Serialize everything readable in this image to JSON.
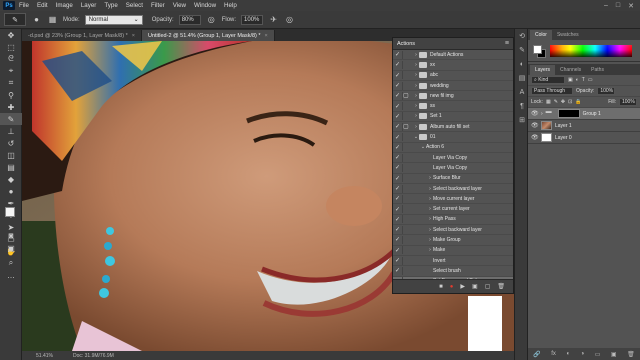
{
  "app": {
    "logo": "Ps"
  },
  "menu": [
    "File",
    "Edit",
    "Image",
    "Layer",
    "Type",
    "Select",
    "Filter",
    "View",
    "Window",
    "Help"
  ],
  "window_controls": [
    "–",
    "□",
    "✕"
  ],
  "options": {
    "mode_label": "Mode:",
    "mode_value": "Normal",
    "opacity_label": "Opacity:",
    "opacity_value": "80%",
    "flow_label": "Flow:",
    "flow_value": "100%"
  },
  "tabs": [
    {
      "label": "-d.psd @ 23% (Group 1, Layer Mask/8) *",
      "active": false
    },
    {
      "label": "Untitled-2 @ 51.4% (Group 1, Layer Mask/8) *",
      "active": true
    }
  ],
  "status": {
    "zoom": "51.41%",
    "doc": "Doc: 31.9M/76.9M"
  },
  "actions_panel": {
    "title": "Actions",
    "rows": [
      {
        "label": "Default Actions",
        "check": true,
        "dialog": false,
        "twisty": "›",
        "kind": "set",
        "indent": 0
      },
      {
        "label": "xx",
        "check": true,
        "dialog": false,
        "twisty": "›",
        "kind": "set",
        "indent": 0
      },
      {
        "label": "abc",
        "check": true,
        "dialog": false,
        "twisty": "›",
        "kind": "set",
        "indent": 0
      },
      {
        "label": "wedding",
        "check": true,
        "dialog": false,
        "twisty": "›",
        "kind": "set",
        "indent": 0
      },
      {
        "label": "new fil img",
        "check": true,
        "dialog": true,
        "twisty": "›",
        "kind": "set",
        "indent": 0
      },
      {
        "label": "ss",
        "check": true,
        "dialog": false,
        "twisty": "›",
        "kind": "set",
        "indent": 0
      },
      {
        "label": "Set 1",
        "check": true,
        "dialog": false,
        "twisty": "›",
        "kind": "set",
        "indent": 0
      },
      {
        "label": "Album auto fill set",
        "check": true,
        "dialog": true,
        "twisty": "›",
        "kind": "set",
        "indent": 0
      },
      {
        "label": "01",
        "check": true,
        "dialog": false,
        "twisty": "⌄",
        "kind": "set",
        "indent": 0
      },
      {
        "label": "Action 6",
        "check": true,
        "dialog": false,
        "twisty": "⌄",
        "kind": "action",
        "indent": 1
      },
      {
        "label": "Layer Via Copy",
        "check": true,
        "dialog": false,
        "twisty": "",
        "kind": "step",
        "indent": 2
      },
      {
        "label": "Layer Via Copy",
        "check": true,
        "dialog": false,
        "twisty": "",
        "kind": "step",
        "indent": 2
      },
      {
        "label": "Surface Blur",
        "check": true,
        "dialog": false,
        "twisty": "›",
        "kind": "step",
        "indent": 2
      },
      {
        "label": "Select backward layer",
        "check": true,
        "dialog": false,
        "twisty": "›",
        "kind": "step",
        "indent": 2
      },
      {
        "label": "Move current layer",
        "check": true,
        "dialog": false,
        "twisty": "›",
        "kind": "step",
        "indent": 2
      },
      {
        "label": "Set current layer",
        "check": true,
        "dialog": false,
        "twisty": "›",
        "kind": "step",
        "indent": 2
      },
      {
        "label": "High Pass",
        "check": true,
        "dialog": false,
        "twisty": "›",
        "kind": "step",
        "indent": 2
      },
      {
        "label": "Select backward layer",
        "check": true,
        "dialog": false,
        "twisty": "›",
        "kind": "step",
        "indent": 2
      },
      {
        "label": "Make Group",
        "check": true,
        "dialog": false,
        "twisty": "›",
        "kind": "step",
        "indent": 2
      },
      {
        "label": "Make",
        "check": true,
        "dialog": false,
        "twisty": "›",
        "kind": "step",
        "indent": 2
      },
      {
        "label": "Invert",
        "check": true,
        "dialog": false,
        "twisty": "",
        "kind": "step",
        "indent": 2
      },
      {
        "label": "Select brush",
        "check": true,
        "dialog": false,
        "twisty": "",
        "kind": "step",
        "indent": 2
      },
      {
        "label": "Set Foreground Color",
        "check": true,
        "dialog": false,
        "twisty": "›",
        "kind": "step",
        "indent": 2,
        "selected": true
      }
    ],
    "footer_icons": [
      "■",
      "●",
      "▶",
      "▣",
      "▢",
      "🗑"
    ]
  },
  "color_panel": {
    "tabs": [
      "Color",
      "Swatches"
    ]
  },
  "layers_panel": {
    "tabs": [
      "Layers",
      "Channels",
      "Paths"
    ],
    "kind_label": "Kind",
    "blend_mode": "Pass Through",
    "opacity_label": "Opacity:",
    "opacity_value": "100%",
    "lock_label": "Lock:",
    "fill_label": "Fill:",
    "fill_value": "100%",
    "layers": [
      {
        "name": "Group 1",
        "type": "group",
        "selected": true
      },
      {
        "name": "Layer 1",
        "type": "image",
        "selected": false
      },
      {
        "name": "Layer 0",
        "type": "white",
        "selected": false
      }
    ],
    "footer_icons": [
      "🔗",
      "fx",
      "◐",
      "◑",
      "▭",
      "▣",
      "🗑"
    ]
  }
}
